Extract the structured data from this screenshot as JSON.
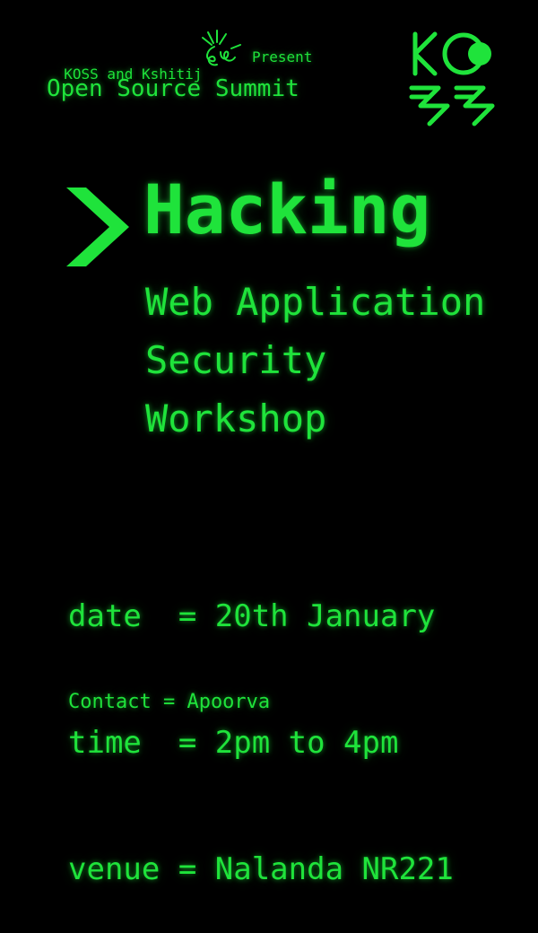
{
  "header": {
    "organizers": "KOSS and Kshitij",
    "present": "Present",
    "event_name": "Open Source Summit"
  },
  "logos": {
    "koss_logo_text": "KOSS",
    "kshitij_logo": "kshitij-logo-icon"
  },
  "title": {
    "prompt_icon": "chevron-right-icon",
    "heading": "Hacking",
    "subtitle_lines": [
      "Web Application",
      "Security",
      "Workshop"
    ]
  },
  "details": {
    "date_line": "date  = 20th January",
    "time_line": "time  = 2pm to 4pm",
    "venue_line": "venue = Nalanda NR221"
  },
  "contact": "Contact = Apoorva",
  "colors": {
    "background": "#000000",
    "accent": "#1fe33b"
  }
}
